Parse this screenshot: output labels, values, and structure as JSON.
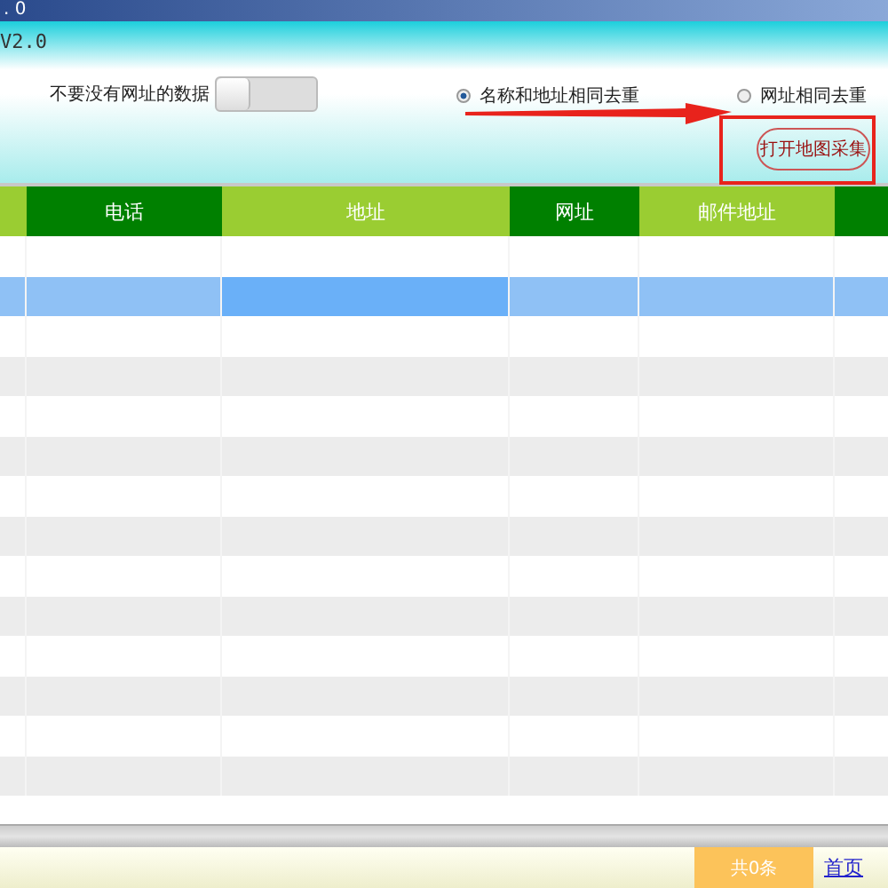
{
  "window": {
    "title": ". 0"
  },
  "panel": {
    "subtitle": "V2.0",
    "filter": {
      "label": "不要没有网址的数据",
      "on": false
    },
    "dedupe_options": [
      {
        "label": "名称和地址相同去重",
        "selected": true
      },
      {
        "label": "网址相同去重",
        "selected": false
      }
    ],
    "map_button": {
      "label": "打开地图采集"
    }
  },
  "table": {
    "columns": [
      {
        "kind": "cut"
      },
      {
        "kind": "full",
        "label": "电话",
        "focused": false
      },
      {
        "kind": "full",
        "label": "地址",
        "focused": true
      },
      {
        "kind": "full",
        "label": "网址",
        "focused": false
      },
      {
        "kind": "full",
        "label": "邮件地址",
        "focused": false
      },
      {
        "kind": "cut"
      }
    ],
    "rows": [
      {
        "selected": false
      },
      {
        "selected": true
      },
      {
        "selected": false
      },
      {
        "selected": false
      },
      {
        "selected": false
      },
      {
        "selected": false
      },
      {
        "selected": false
      },
      {
        "selected": false
      },
      {
        "selected": false
      },
      {
        "selected": false
      },
      {
        "selected": false
      },
      {
        "selected": false
      },
      {
        "selected": false
      },
      {
        "selected": false
      }
    ]
  },
  "status_bar": {
    "count": "共0条",
    "first_page": "首页"
  }
}
